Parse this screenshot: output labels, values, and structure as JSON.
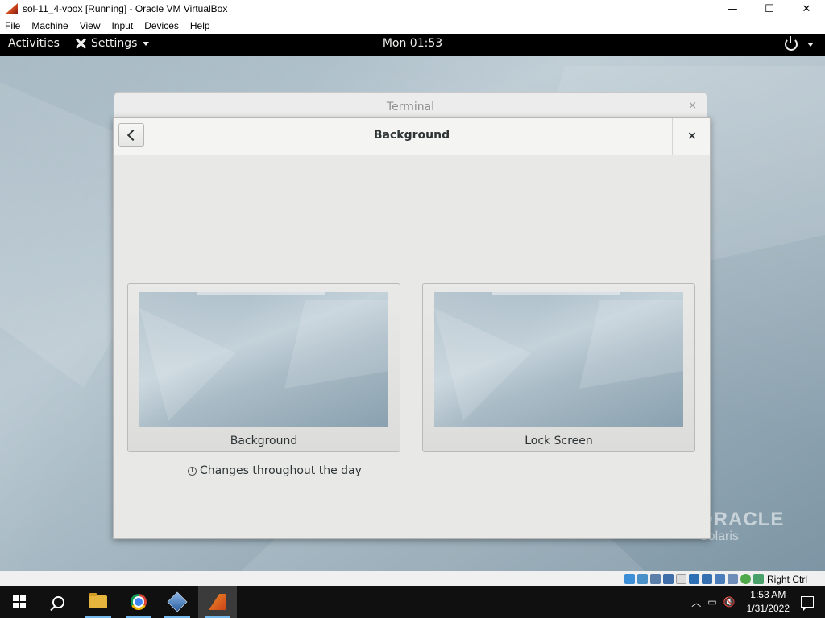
{
  "host_window": {
    "title": "sol-11_4-vbox [Running] - Oracle VM VirtualBox",
    "controls": {
      "minimize": "—",
      "maximize": "☐",
      "close": "✕"
    },
    "menu": [
      "File",
      "Machine",
      "View",
      "Input",
      "Devices",
      "Help"
    ]
  },
  "guest_topbar": {
    "activities": "Activities",
    "app_menu": "Settings",
    "clock": "Mon 01:53"
  },
  "terminal": {
    "title": "Terminal",
    "close": "×"
  },
  "dialog": {
    "title": "Background",
    "close": "×",
    "tiles": [
      {
        "label": "Background"
      },
      {
        "label": "Lock Screen"
      }
    ],
    "note": "Changes throughout the day"
  },
  "wallpaper_brand": {
    "line1": "ORACLE",
    "line2": "Solaris"
  },
  "vbox_status": {
    "host_key": "Right Ctrl"
  },
  "taskbar": {
    "time": "1:53 AM",
    "date": "1/31/2022"
  },
  "colors": {
    "guest_topbar": "#000000",
    "taskbar": "#101010",
    "accent": "#76b9ed"
  }
}
